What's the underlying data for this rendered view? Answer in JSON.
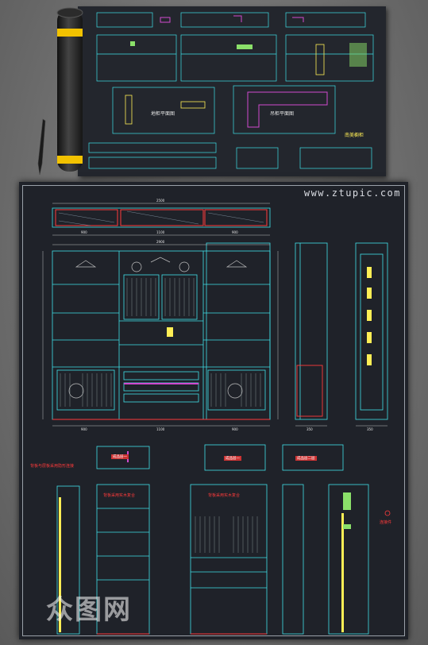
{
  "watermark_site": "www.ztupic.com",
  "preview": {
    "plan_left": "地柜平面图",
    "plan_right": "吊柜平面图",
    "corner_title": "南美橱柜"
  },
  "dimensions": {
    "top_overall": "2500",
    "top_left": "900",
    "top_mid": "1100",
    "top_right": "900",
    "front_overall": "2900",
    "bottom_left": "900",
    "bottom_mid": "1100",
    "bottom_right": "900",
    "side_width": "350",
    "side_width2": "350"
  },
  "labels": {
    "side_note": "背板与层板采用隐形连接",
    "panel_1": "成品层一",
    "panel_2": "成品层一",
    "panel_3": "成品层二层",
    "mid_note_1": "背板采用实木复合",
    "mid_note_2": "背板采用实木复合",
    "right_note": "连接件"
  },
  "bottom_watermark": "众图网",
  "colors": {
    "cad_bg": "#1f2229",
    "cyan": "#3fe0e8",
    "red": "#ff3b3b",
    "yellow": "#ffee55",
    "magenta": "#d04ad0"
  }
}
